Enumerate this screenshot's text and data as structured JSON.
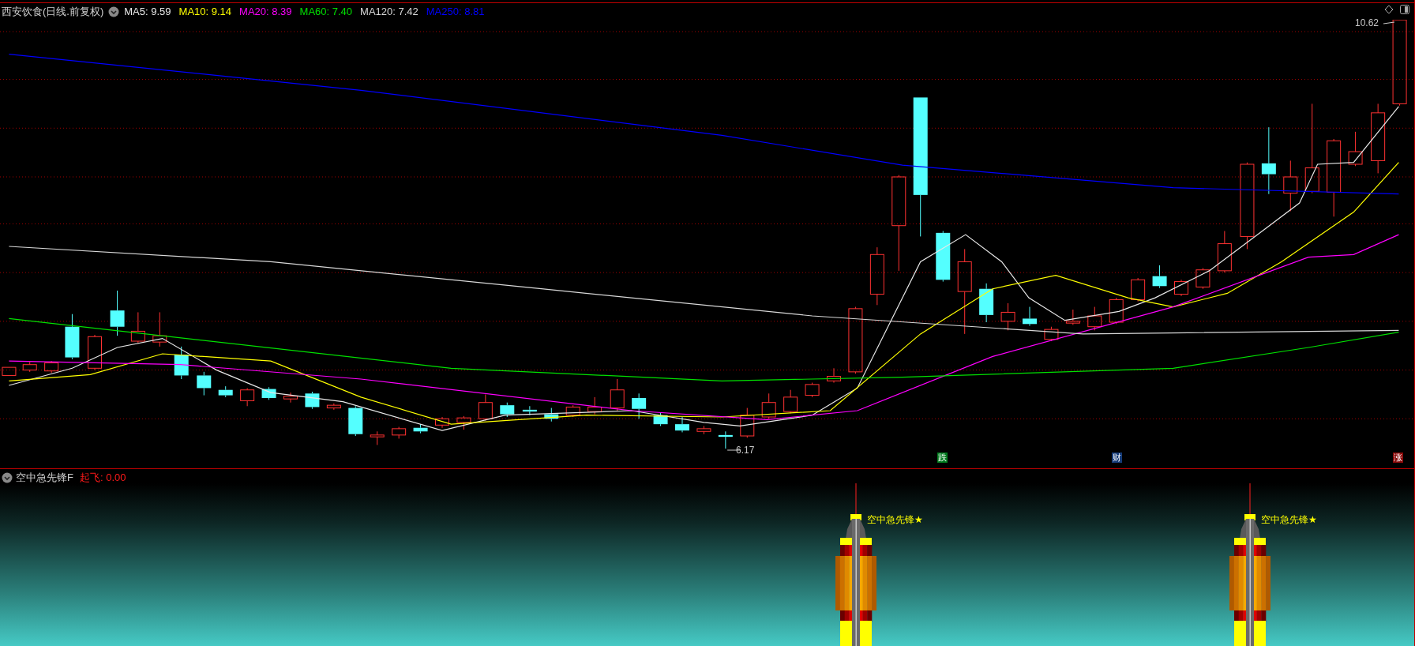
{
  "header": {
    "title": "西安饮食(日线.前复权)",
    "moving_averages": [
      {
        "text": "MA5: 9.59",
        "color": "#e8e8e8"
      },
      {
        "text": "MA10: 9.14",
        "color": "#ffff00"
      },
      {
        "text": "MA20: 8.39",
        "color": "#ff00ff"
      },
      {
        "text": "MA60: 7.40",
        "color": "#00e000"
      },
      {
        "text": "MA120: 7.42",
        "color": "#d8d8d8"
      },
      {
        "text": "MA250: 8.81",
        "color": "#0000ff"
      }
    ]
  },
  "price_chart": {
    "high_label": "10.62",
    "low_label": "6.17",
    "signals": [
      {
        "text": "跌",
        "color": "#007a1e"
      },
      {
        "text": "财",
        "color": "#163c78"
      },
      {
        "text": "涨",
        "color": "#8a0a0a"
      }
    ]
  },
  "indicator_panel": {
    "title": "空中急先锋F",
    "reading": "起飞: 0.00",
    "rockets": [
      {
        "label": "空中急先锋★"
      },
      {
        "label": "空中急先锋★"
      }
    ]
  }
}
